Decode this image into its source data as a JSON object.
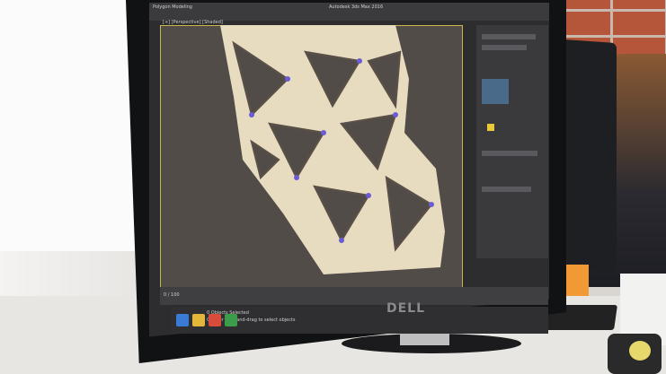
{
  "scene": {
    "description_items": [
      "wall-left",
      "window-frame",
      "brick-wall",
      "person",
      "desk",
      "monitor",
      "keyboard",
      "tape-dispenser"
    ]
  },
  "app": {
    "title": "Autodesk 3ds Max 2016",
    "ribbon_label": "Polygon Modeling",
    "viewport_label": "[+] [Perspective] [Shaded]",
    "status_text": "0 Objects Selected",
    "prompt_text": "Click or click-and-drag to select objects",
    "timeline_label": "0 / 100"
  },
  "monitor": {
    "brand": "DELL"
  },
  "colors": {
    "viewport_border": "#c9b94a",
    "mesh_fill": "#e8dcc0",
    "mesh_vertices": "#6a5bd6"
  }
}
